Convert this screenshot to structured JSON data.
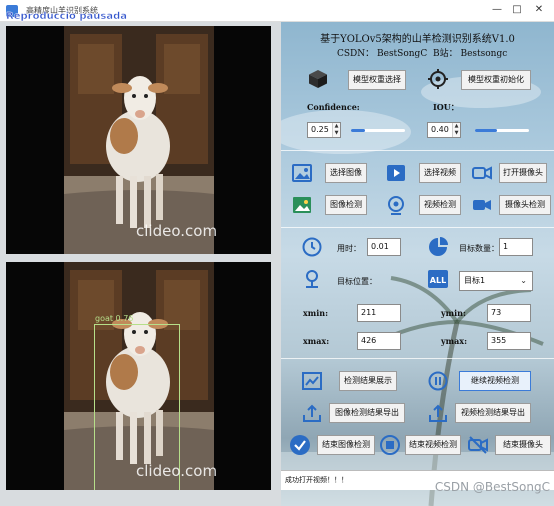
{
  "window": {
    "title": "高精度山羊识别系统",
    "overlay_text": "Reproduccio pausada",
    "controls": {
      "minimize": "—",
      "maximize": "□",
      "close": "✕"
    }
  },
  "video": {
    "watermark": "clideo.com",
    "detection_label": "goat 0.76"
  },
  "header": {
    "title": "基于YOLOv5架构的山羊检测识别系统V1.0",
    "csdn": "CSDN： BestSongC",
    "bilibili": "B站： Bestsongc"
  },
  "model": {
    "select_button": "模型权重选择",
    "init_button": "模型权重初始化",
    "cube_icon": "model-cube-icon",
    "target_icon": "target-icon"
  },
  "params": {
    "confidence_label": "Confidence:",
    "confidence_value": "0.25",
    "confidence_level": 0.25,
    "iou_label": "IOU：",
    "iou_value": "0.40",
    "iou_level": 0.4
  },
  "media": {
    "select_image": "选择图像",
    "select_video": "选择视频",
    "open_camera": "打开摄像头",
    "image_detect": "图像检测",
    "video_detect": "视频检测",
    "camera_detect": "摄像头检测"
  },
  "stats": {
    "time_label": "用时：",
    "time_value": "0.01",
    "count_label": "目标数量：",
    "count_value": "1",
    "position_label": "目标位置：",
    "target_select": "目标1",
    "xmin_label": "xmin:",
    "xmin_value": "211",
    "ymin_label": "ymin:",
    "ymin_value": "73",
    "xmax_label": "xmax:",
    "xmax_value": "426",
    "ymax_label": "ymax:",
    "ymax_value": "355"
  },
  "actions": {
    "show_results": "检测结果展示",
    "continue_video": "继续视频检测",
    "export_image": "图像检测结果导出",
    "export_video": "视频检测结果导出",
    "end_image": "结束图像检测",
    "end_video": "结束视频检测",
    "end_camera": "结束摄像头"
  },
  "status": {
    "message": "成功打开视频！！！"
  },
  "corner_watermark": "CSDN @BestSongC",
  "colors": {
    "accent": "#3b7bd8",
    "detection_box": "#b6df8a",
    "overlay_text": "#3355cc"
  }
}
